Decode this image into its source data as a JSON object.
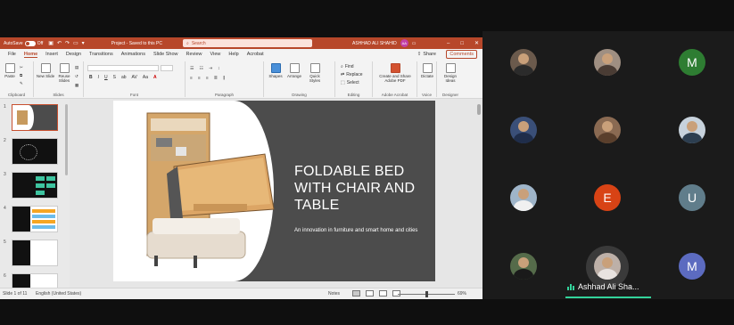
{
  "ppt": {
    "titlebar": {
      "autosave_label": "AutoSave",
      "autosave_state": "Off",
      "title": "Project - Saved to this PC",
      "search_placeholder": "Search",
      "user_name": "ASHHAD ALI SHAHID",
      "user_initials": "AA"
    },
    "tabs": [
      "File",
      "Home",
      "Insert",
      "Design",
      "Transitions",
      "Animations",
      "Slide Show",
      "Review",
      "View",
      "Help",
      "Acrobat"
    ],
    "active_tab": "Home",
    "share_label": "Share",
    "comments_label": "Comments",
    "ribbon": {
      "clipboard": {
        "label": "Clipboard",
        "paste": "Paste"
      },
      "slides": {
        "label": "Slides",
        "new_slide": "New Slide",
        "reuse_slides": "Reuse Slides"
      },
      "font": {
        "label": "Font",
        "buttons": [
          "B",
          "I",
          "U",
          "S",
          "ab",
          "AV",
          "Aa",
          "A"
        ]
      },
      "paragraph": {
        "label": "Paragraph"
      },
      "drawing": {
        "label": "Drawing",
        "shapes": "Shapes",
        "arrange": "Arrange",
        "quick_styles": "Quick Styles"
      },
      "editing": {
        "label": "Editing",
        "find": "Find",
        "replace": "Replace",
        "select": "Select"
      },
      "adobe": {
        "label": "Adobe Acrobat",
        "create": "Create and Share Adobe PDF"
      },
      "voice": {
        "label": "Voice",
        "dictate": "Dictate"
      },
      "designer": {
        "label": "Designer",
        "design_ideas": "Design Ideas"
      }
    },
    "thumbnails": [
      "1",
      "2",
      "3",
      "4",
      "5",
      "6"
    ],
    "slide": {
      "title": "FOLDABLE BED WITH CHAIR AND TABLE",
      "subtitle": "An innovation in furniture and smart home and cities"
    },
    "status": {
      "slide_count": "Slide 1 of 11",
      "language": "English (United States)",
      "notes": "Notes",
      "zoom": "69%"
    }
  },
  "participants": [
    {
      "name": "participant-1",
      "kind": "photo"
    },
    {
      "name": "participant-2",
      "kind": "photo"
    },
    {
      "name": "participant-m",
      "initial": "M",
      "color": "#2e7d32"
    },
    {
      "name": "participant-4",
      "kind": "photo"
    },
    {
      "name": "participant-5",
      "kind": "photo"
    },
    {
      "name": "participant-6",
      "kind": "photo"
    },
    {
      "name": "participant-7",
      "kind": "photo"
    },
    {
      "name": "participant-e",
      "initial": "E",
      "color": "#d84315"
    },
    {
      "name": "participant-u",
      "initial": "U",
      "color": "#607d8b"
    },
    {
      "name": "participant-10",
      "kind": "photo"
    },
    {
      "name": "participant-m2",
      "initial": "M",
      "color": "#5c6bc0"
    }
  ],
  "active_speaker": {
    "label": "Ashhad Ali Sha..."
  },
  "colors": {
    "accent": "#b7472a",
    "speaker_green": "#33d39b"
  }
}
